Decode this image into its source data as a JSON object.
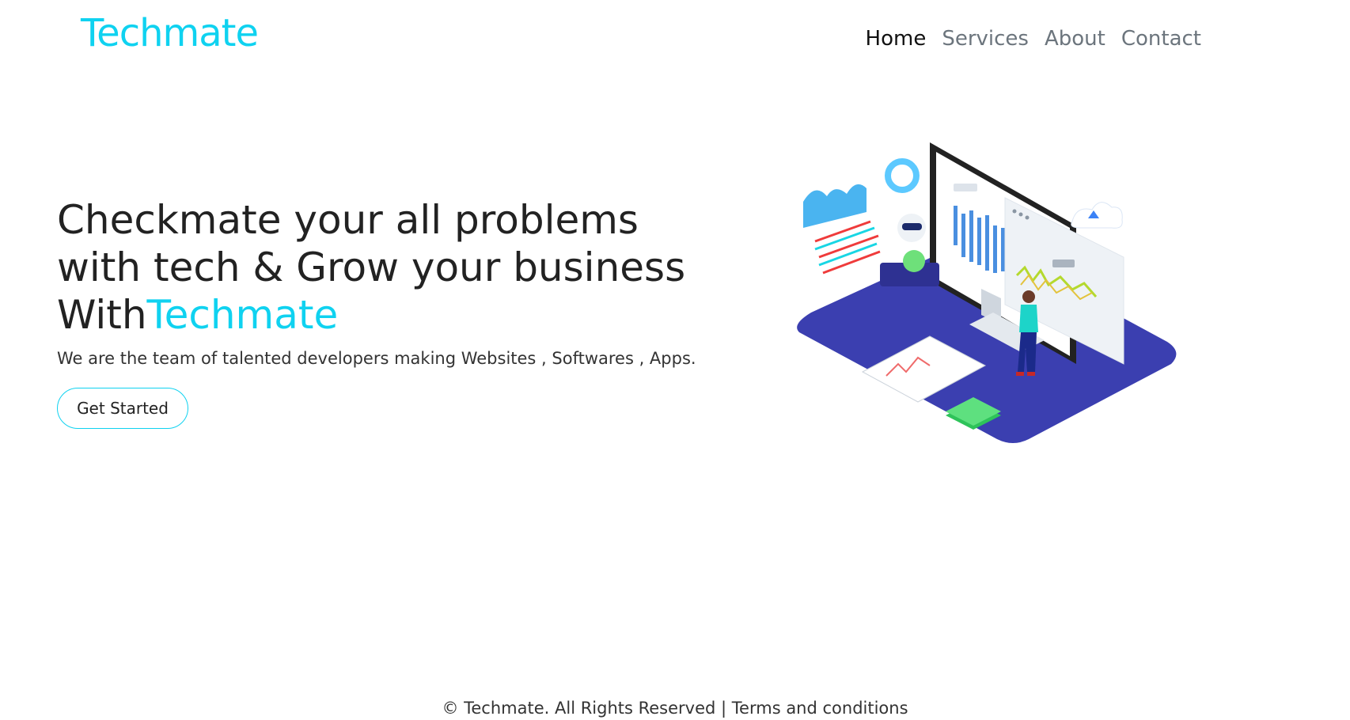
{
  "colors": {
    "accent": "#0fd2f0",
    "platform": "#3b3fb0"
  },
  "header": {
    "brand": "Techmate",
    "nav": [
      {
        "label": "Home",
        "active": true
      },
      {
        "label": "Services",
        "active": false
      },
      {
        "label": "About",
        "active": false
      },
      {
        "label": "Contact",
        "active": false
      }
    ]
  },
  "hero": {
    "title_line1": "Checkmate your all problems",
    "title_line2": "with tech & Grow your business",
    "title_prefix": "With",
    "title_brand": "Techmate",
    "subtitle": "We are the team of talented developers making Websites , Softwares , Apps.",
    "cta_label": "Get Started"
  },
  "illustration": {
    "icon": "analytics-illustration"
  },
  "footer": {
    "copyright": "© Techmate. All Rights Reserved",
    "separator": " | ",
    "terms": "Terms and conditions"
  }
}
